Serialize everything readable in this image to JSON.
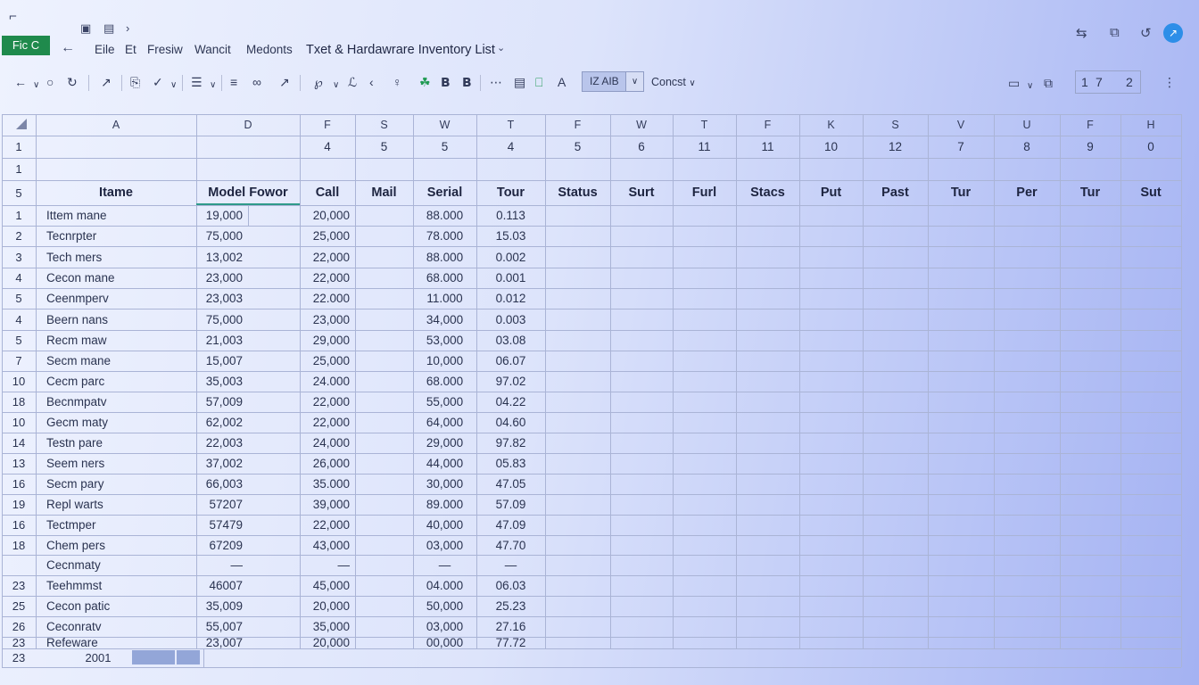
{
  "titlebar": {
    "file_label": "Fic C",
    "menu": [
      "Eile",
      "Et",
      "Fresiw",
      "Wancit",
      "Medonts"
    ],
    "document_title": "Txet & Hardawrare Inventory List"
  },
  "toolbar": {
    "format_value": "IZ AIB",
    "const_label": "Concst",
    "page_first": "1",
    "page_current": "7",
    "page_total": "2"
  },
  "columns": [
    "A",
    "D",
    "F",
    "S",
    "W",
    "T",
    "F",
    "W",
    "T",
    "F",
    "K",
    "S",
    "V",
    "U",
    "F",
    "H"
  ],
  "row1_values": [
    "",
    "",
    "4",
    "5",
    "5",
    "4",
    "5",
    "6",
    "11",
    "11",
    "10",
    "12",
    "7",
    "8",
    "9",
    "0"
  ],
  "headers": [
    "Itame",
    "Model Fowor",
    "Call",
    "Mail",
    "Serial",
    "Tour",
    "Status",
    "Surt",
    "Furl",
    "Stacs",
    "Put",
    "Past",
    "Tur",
    "Per",
    "Tur",
    "Sut"
  ],
  "rows": [
    {
      "num": "1",
      "name": "Ittem mane",
      "model": "19,000",
      "call": "20,000",
      "serial": "88.000",
      "tour": "0.113"
    },
    {
      "num": "2",
      "name": "Tecnrpter",
      "model": "75,000",
      "call": "25,000",
      "serial": "78.000",
      "tour": "15.03"
    },
    {
      "num": "3",
      "name": "Tech mers",
      "model": "13,002",
      "call": "22,000",
      "serial": "88.000",
      "tour": "0.002"
    },
    {
      "num": "4",
      "name": "Cecon mane",
      "model": "23,000",
      "call": "22,000",
      "serial": "68.000",
      "tour": "0.001"
    },
    {
      "num": "5",
      "name": "Ceenmperv",
      "model": "23,003",
      "call": "22.000",
      "serial": "11.000",
      "tour": "0.012"
    },
    {
      "num": "4",
      "name": "Beern nans",
      "model": "75,000",
      "call": "23,000",
      "serial": "34,000",
      "tour": "0.003"
    },
    {
      "num": "5",
      "name": "Recm maw",
      "model": "21,003",
      "call": "29,000",
      "serial": "53,000",
      "tour": "03.08"
    },
    {
      "num": "7",
      "name": "Secm mane",
      "model": "15,007",
      "call": "25,000",
      "serial": "10,000",
      "tour": "06.07"
    },
    {
      "num": "10",
      "name": "Cecm parc",
      "model": "35,003",
      "call": "24.000",
      "serial": "68.000",
      "tour": "97.02"
    },
    {
      "num": "18",
      "name": "Becnmpatv",
      "model": "57,009",
      "call": "22,000",
      "serial": "55,000",
      "tour": "04.22"
    },
    {
      "num": "10",
      "name": "Gecm maty",
      "model": "62,002",
      "call": "22,000",
      "serial": "64,000",
      "tour": "04.60"
    },
    {
      "num": "14",
      "name": "Testn pare",
      "model": "22,003",
      "call": "24,000",
      "serial": "29,000",
      "tour": "97.82"
    },
    {
      "num": "13",
      "name": "Seem ners",
      "model": "37,002",
      "call": "26,000",
      "serial": "44,000",
      "tour": "05.83"
    },
    {
      "num": "16",
      "name": "Secm pary",
      "model": "66,003",
      "call": "35.000",
      "serial": "30,000",
      "tour": "47.05"
    },
    {
      "num": "19",
      "name": "Repl warts",
      "model": "57207",
      "call": "39,000",
      "serial": "89.000",
      "tour": "57.09"
    },
    {
      "num": "16",
      "name": "Tectmper",
      "model": "57479",
      "call": "22,000",
      "serial": "40,000",
      "tour": "47.09"
    },
    {
      "num": "18",
      "name": "Chem pers",
      "model": "67209",
      "call": "43,000",
      "serial": "03,000",
      "tour": "47.70"
    },
    {
      "num": "",
      "name": "Cecnmaty",
      "model": "—",
      "call": "—",
      "serial": "—",
      "tour": "—"
    },
    {
      "num": "23",
      "name": "Teehmmst",
      "model": "46007",
      "call": "45,000",
      "serial": "04.000",
      "tour": "06.03"
    },
    {
      "num": "25",
      "name": "Cecon patic",
      "model": "35,009",
      "call": "20,000",
      "serial": "50,000",
      "tour": "25.23"
    },
    {
      "num": "26",
      "name": "Ceconratv",
      "model": "55,007",
      "call": "35,000",
      "serial": "03,000",
      "tour": "27.16"
    },
    {
      "num": "23",
      "name": "Refeware",
      "model": "23,007",
      "call": "20,000",
      "serial": "00,000",
      "tour": "77.72"
    }
  ],
  "footer": {
    "row_num": "23",
    "value": "2001"
  },
  "colors": {
    "accent_green": "#1f8a4c",
    "sync_blue": "#2d8ee8",
    "grid_line": "#aab4d6"
  }
}
